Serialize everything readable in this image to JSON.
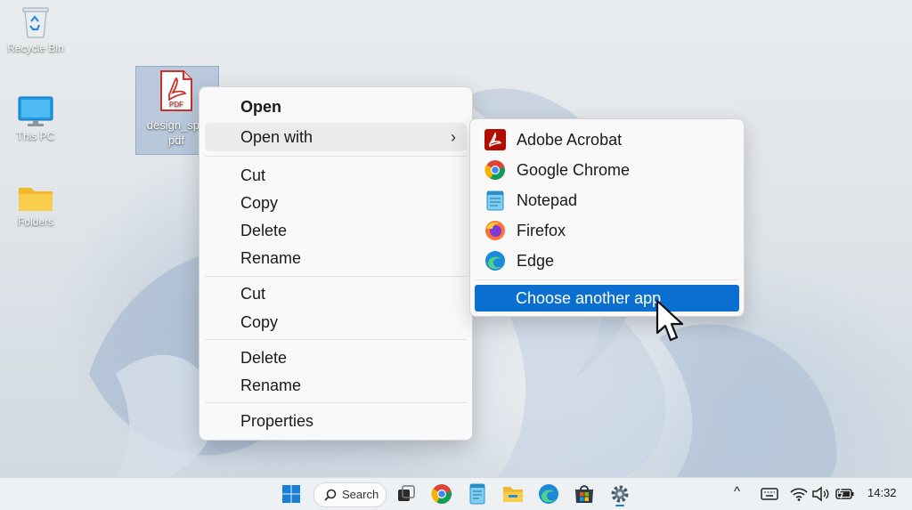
{
  "desktop": {
    "icons": [
      {
        "label": "Recycle Bin"
      },
      {
        "label": "This PC"
      },
      {
        "label": "Folders"
      }
    ],
    "file": {
      "label_line1": "design_spe",
      "label_line2": "pdf",
      "badge": "PDF"
    }
  },
  "context_menu": {
    "open": "Open",
    "open_with": "Open with",
    "cut_1": "Cut",
    "copy_1": "Copy",
    "delete_1": "Delete",
    "rename_1": "Rename",
    "cut_2": "Cut",
    "copy_2": "Copy",
    "delete_2": "Delete",
    "rename_2": "Rename",
    "properties": "Properties"
  },
  "open_with_menu": {
    "apps": [
      {
        "label": "Adobe Acrobat",
        "icon": "acrobat-icon"
      },
      {
        "label": "Google Chrome",
        "icon": "chrome-icon"
      },
      {
        "label": "Notepad",
        "icon": "notepad-icon"
      },
      {
        "label": "Firefox",
        "icon": "firefox-icon"
      },
      {
        "label": "Edge",
        "icon": "edge-icon"
      }
    ],
    "choose_another": "Choose another app"
  },
  "taskbar": {
    "search_label": "Search",
    "clock": "14:32"
  },
  "colors": {
    "accent": "#0a6fd1",
    "menu_bg": "#f9f9f9"
  }
}
